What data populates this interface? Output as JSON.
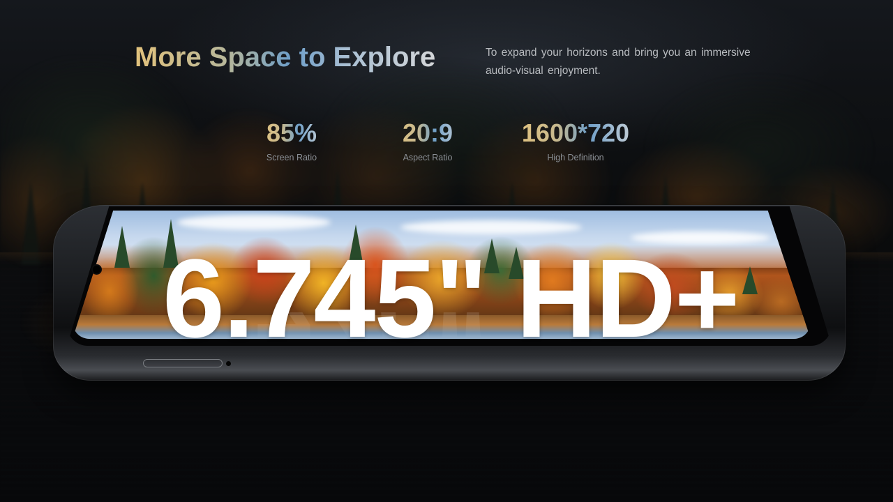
{
  "headline": "More Space to Explore",
  "tagline": "To expand your horizons and bring you an immersive audio-visual enjoyment.",
  "stats": [
    {
      "value": "85%",
      "label": "Screen Ratio"
    },
    {
      "value": "20:9",
      "label": "Aspect Ratio"
    },
    {
      "value": "1600*720",
      "label": "High Definition"
    }
  ],
  "display_size": "6.745\" HD+",
  "colors": {
    "gold": "#e2c27c",
    "blue": "#6d9ec9",
    "silver": "#d4d6d8"
  }
}
